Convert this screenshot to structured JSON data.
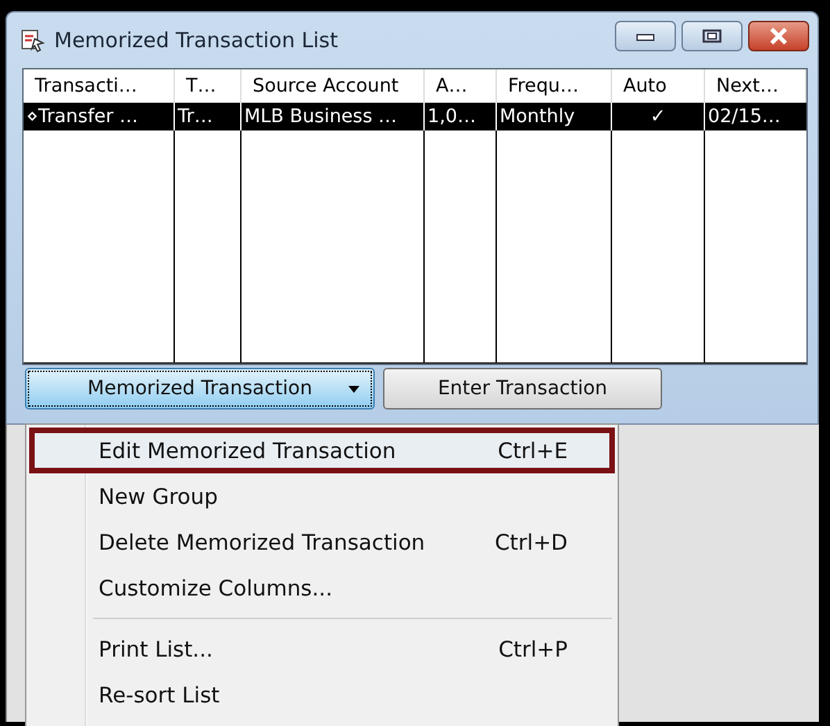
{
  "window": {
    "title": "Memorized Transaction List"
  },
  "table": {
    "columns": [
      "Transacti…",
      "T…",
      "Source Account",
      "A…",
      "Frequ…",
      "Auto",
      "Next…"
    ],
    "rows": [
      {
        "selected": true,
        "cells": [
          "⋄Transfer …",
          "Tr…",
          "MLB Business …",
          "1,0…",
          "Monthly",
          "✓",
          "02/15…"
        ]
      }
    ]
  },
  "buttons": [
    {
      "label": "Memorized Transaction",
      "kind": "dropdown",
      "focused": true
    },
    {
      "label": "Enter Transaction",
      "kind": "plain",
      "focused": false
    }
  ],
  "menu": {
    "items": [
      {
        "kind": "item",
        "label": "Edit Memorized Transaction",
        "shortcut": "Ctrl+E",
        "selected": true
      },
      {
        "kind": "item",
        "label": "New Group",
        "selected": false
      },
      {
        "kind": "item",
        "label": "Delete Memorized Transaction",
        "shortcut": "Ctrl+D",
        "selected": false
      },
      {
        "kind": "item",
        "label": "Customize Columns...",
        "selected": false
      },
      {
        "kind": "separator"
      },
      {
        "kind": "item",
        "label": "Print List...",
        "shortcut": "Ctrl+P",
        "selected": false
      },
      {
        "kind": "item",
        "label": "Re-sort List",
        "selected": false
      }
    ]
  }
}
